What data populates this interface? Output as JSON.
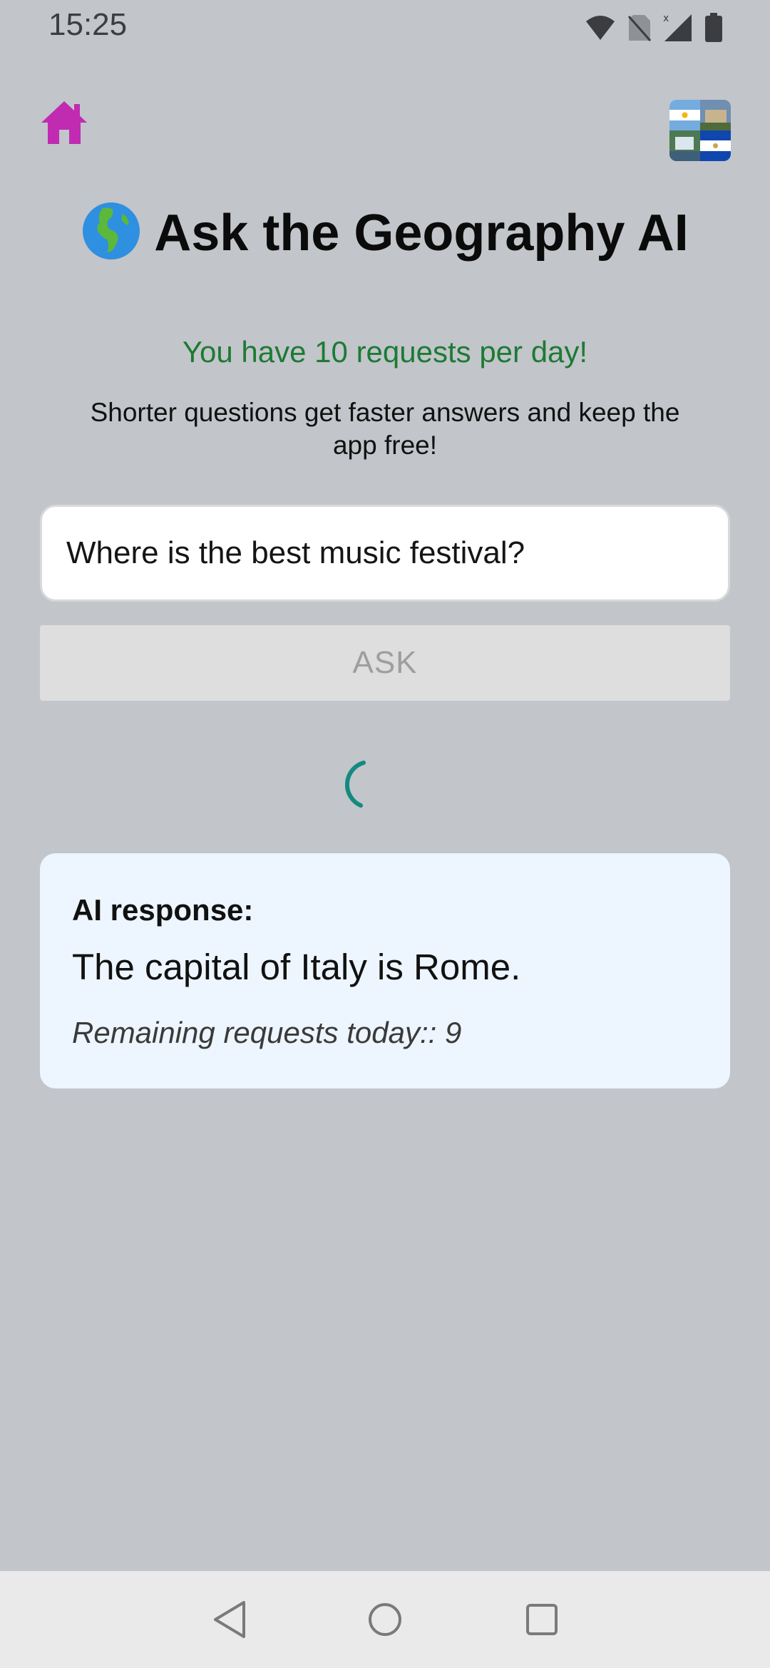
{
  "status_bar": {
    "time": "15:25",
    "icons": [
      "wifi-icon",
      "no-sim-icon",
      "signal-icon",
      "battery-icon"
    ]
  },
  "header": {
    "home_icon": "home-icon",
    "flags_icon": "flags-collage-icon"
  },
  "title": {
    "emoji": "globe-icon",
    "text": "Ask the Geography AI"
  },
  "limit_text": "You have 10 requests per day!",
  "hint_text": "Shorter questions get faster answers and keep the app free!",
  "question": {
    "value": "Where is the best music festival?",
    "placeholder": ""
  },
  "ask_button": {
    "label": "ASK",
    "enabled": false
  },
  "response": {
    "label": "AI response:",
    "answer": "The capital of Italy is Rome.",
    "remaining": "Remaining requests today:: 9"
  },
  "nav_bar": {
    "buttons": [
      "back-icon",
      "home-circle-icon",
      "recents-icon"
    ]
  },
  "colors": {
    "background": "#c2c5ca",
    "home_icon": "#c02bb2",
    "limit_text": "#1d7a34",
    "spinner": "#138a80",
    "card_bg": "#edf5fe"
  }
}
